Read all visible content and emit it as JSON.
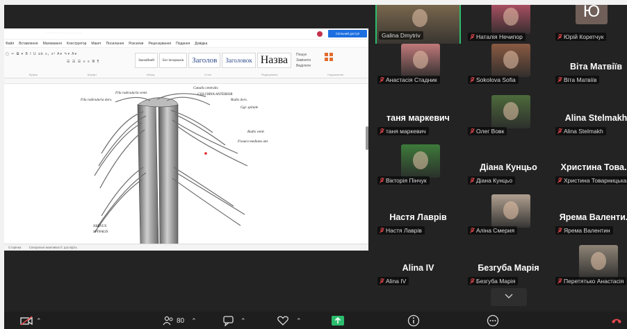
{
  "document": {
    "tabs": [
      "Файл",
      "Вставлення",
      "Малювання",
      "Конструктор",
      "Макет",
      "Посилання",
      "Розсилки",
      "Рецензування",
      "Подання",
      "Довідка"
    ],
    "share_button": "Спільний доступ",
    "styles": [
      "Звичайний",
      "Без інтервалів",
      "Заголов",
      "Заголовок",
      "Назва"
    ],
    "ribbon_right": [
      "Пошук",
      "Замінити",
      "Виділити"
    ],
    "ribbon_groups": [
      "Буфер",
      "Шрифт",
      "Абзац",
      "Стилі",
      "Редагування",
      "Надсилання"
    ],
    "statusbar": [
      "Сторінка",
      "Спеціальні можливості: дослідіть"
    ],
    "illustration_labels": [
      "Fila radicularia dors.",
      "Fila radicularia ventr.",
      "Canalis centralis",
      "COLUMNA ANTERIOR",
      "Radix dors.",
      "Ggl. spinale",
      "Radix ventr.",
      "Fissura mediana ant.",
      "NERVUS",
      "SPINALIS"
    ]
  },
  "participants": [
    {
      "name": "Galina Dmytriv",
      "kind": "video",
      "active": true,
      "tone": "#7d6a4f"
    },
    {
      "name": "Наталія Нечипор",
      "kind": "video",
      "tone": "#b85468"
    },
    {
      "name": "Юрій Коретчук",
      "kind": "avatar",
      "initial": "Ю"
    },
    {
      "name": "Анастасія Стадник",
      "kind": "video",
      "tone": "#c0797a"
    },
    {
      "name": "Sokolova Sofia",
      "kind": "video",
      "tone": "#8a5a42"
    },
    {
      "name": "Віта Матвіїв",
      "kind": "text",
      "big": "Віта Матвіїв"
    },
    {
      "name": "таня маркевич",
      "kind": "text",
      "big": "таня маркевич"
    },
    {
      "name": "Олег Вовк",
      "kind": "video",
      "tone": "#4d6a3c"
    },
    {
      "name": "Alina Stelmakh",
      "kind": "text",
      "big": "Alina Stelmakh"
    },
    {
      "name": "Вікторія Пінчук",
      "kind": "video",
      "tone": "#3d7a3a"
    },
    {
      "name": "Діана Кунцьо",
      "kind": "text",
      "big": "Діана Кунцьо"
    },
    {
      "name": "Христина Товарницька",
      "kind": "text",
      "big": "Христина Това..."
    },
    {
      "name": "Настя Лаврів",
      "kind": "text",
      "big": "Настя Лаврів"
    },
    {
      "name": "Аліна Смерия",
      "kind": "video",
      "tone": "#b0a090"
    },
    {
      "name": "Ярема Валентин",
      "kind": "text",
      "big": "Ярема Валенти..."
    },
    {
      "name": "Alina IV",
      "kind": "text",
      "big": "Alina IV"
    },
    {
      "name": "Безгуба Марія",
      "kind": "text",
      "big": "Безгуба Марія"
    },
    {
      "name": "Перетятько Анастасія",
      "kind": "video",
      "tone": "#8e8476"
    }
  ],
  "toolbar": {
    "participants_count": "80"
  },
  "colors": {
    "active_speaker": "#2dbd6e",
    "muted_icon": "#e5484d",
    "share_icon": "#2dbd6e",
    "background": "#232323"
  }
}
